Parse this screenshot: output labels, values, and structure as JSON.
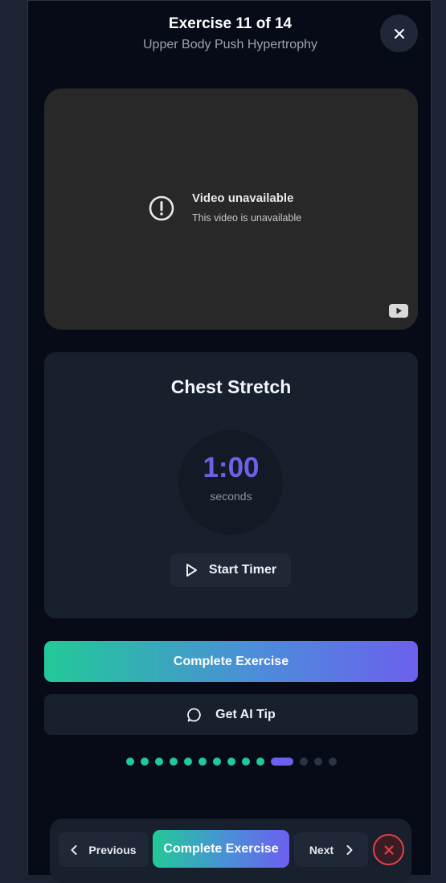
{
  "header": {
    "title": "Exercise 11 of 14",
    "subtitle": "Upper Body Push Hypertrophy",
    "close_icon": "close-icon"
  },
  "video": {
    "title": "Video unavailable",
    "message": "This video is unavailable",
    "alert_icon": "alert-circle-icon",
    "brand_icon": "youtube-icon"
  },
  "exercise": {
    "name": "Chest Stretch",
    "timer_value": "1:00",
    "timer_unit": "seconds",
    "start_label": "Start Timer",
    "start_icon": "play-icon"
  },
  "actions": {
    "complete_label": "Complete Exercise",
    "tip_label": "Get AI Tip",
    "tip_icon": "chat-bubble-icon"
  },
  "progress": {
    "total": 14,
    "current": 11,
    "completed": 10
  },
  "bottom_nav": {
    "previous_label": "Previous",
    "complete_label": "Complete Exercise",
    "next_label": "Next",
    "exit_icon": "close-icon"
  },
  "colors": {
    "accent_green": "#22c997",
    "accent_purple": "#6c60ee",
    "danger": "#e2424a",
    "background": "#060b17"
  }
}
